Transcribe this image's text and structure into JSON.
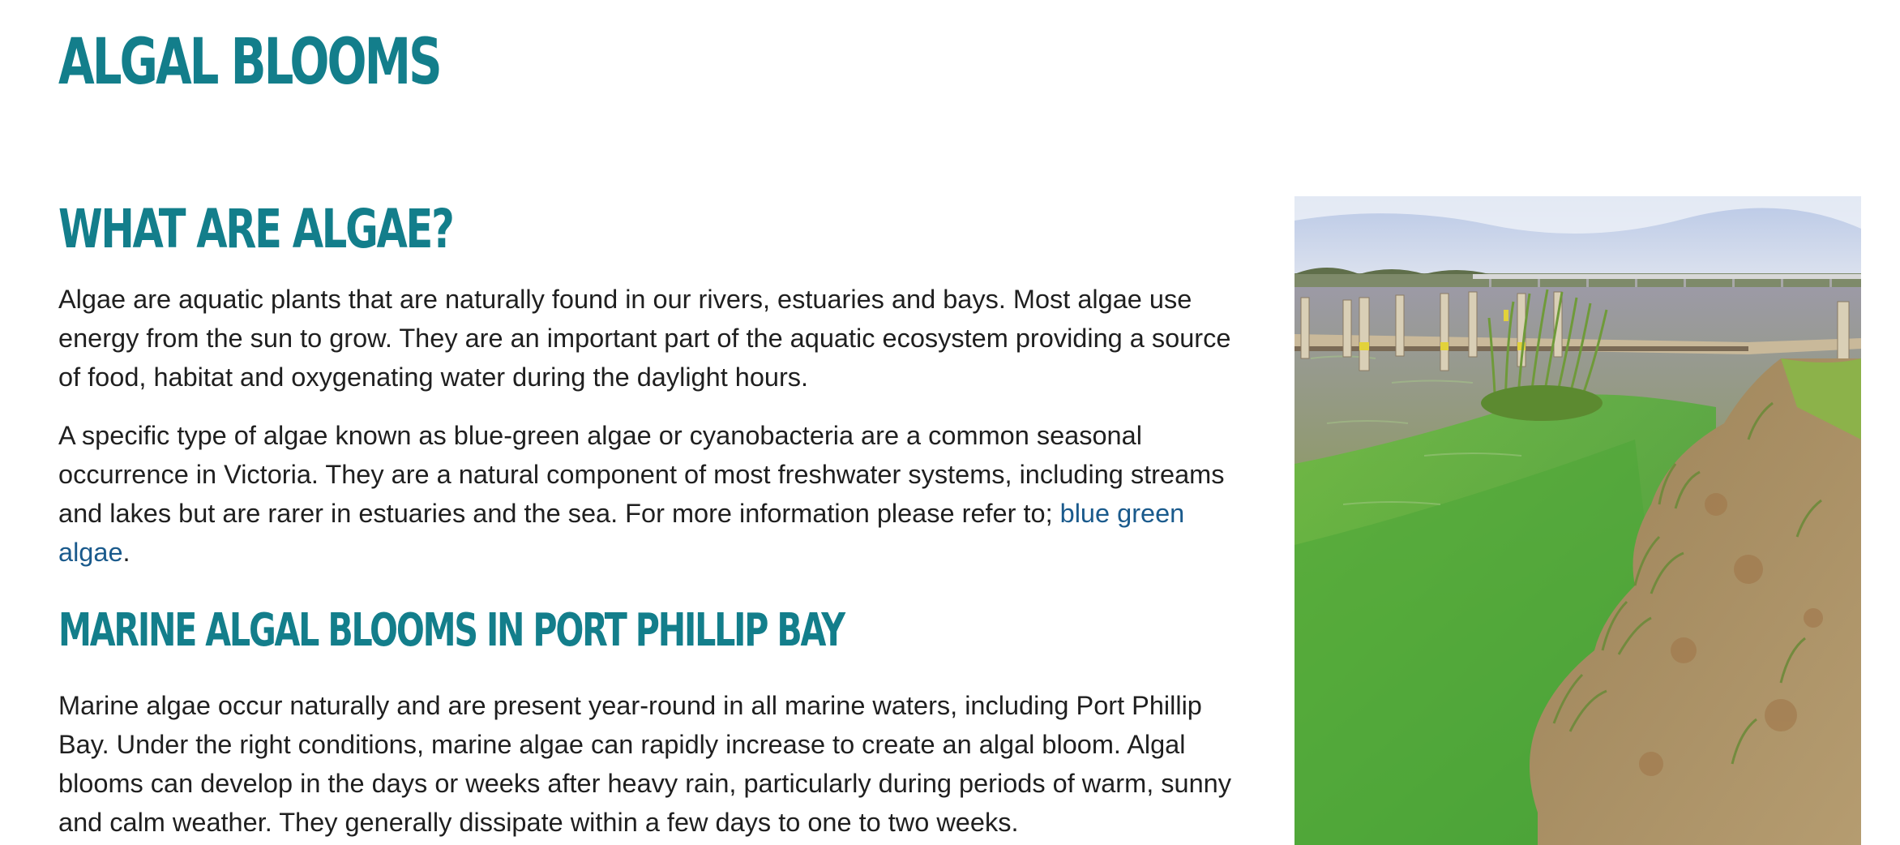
{
  "page": {
    "title": "ALGAL BLOOMS"
  },
  "sections": {
    "what": {
      "heading": "WHAT ARE ALGAE?",
      "para1": "Algae are aquatic plants that are naturally found in our rivers, estuaries and bays. Most algae use energy from the sun to grow. They are an important part of the aquatic ecosystem providing a source of food, habitat and oxygenating water during the daylight hours.",
      "para2_text": "A specific type of algae known as blue-green algae or cyanobacteria are a common seasonal occurrence in Victoria. They are a natural component of most freshwater systems, including streams and lakes but are rarer in estuaries and the sea. For more information please refer to; ",
      "para2_link": "blue green algae",
      "para2_end": "."
    },
    "marine": {
      "heading": "MARINE ALGAL BLOOMS IN PORT PHILLIP BAY",
      "para1": "Marine algae occur naturally and are present year-round in all marine waters, including Port Phillip Bay. Under the right conditions, marine algae can rapidly increase to create an algal bloom. Algal blooms can develop in the days or weeks after heavy rain, particularly during periods of warm, sunny and calm weather. They generally dissipate within a few days to one to two weeks."
    }
  },
  "colors": {
    "heading": "#137e8b",
    "body_text": "#1f1f1f",
    "link": "#1a5a8c",
    "algae_water": "#5aa840",
    "sky": "#c9d4ea"
  }
}
